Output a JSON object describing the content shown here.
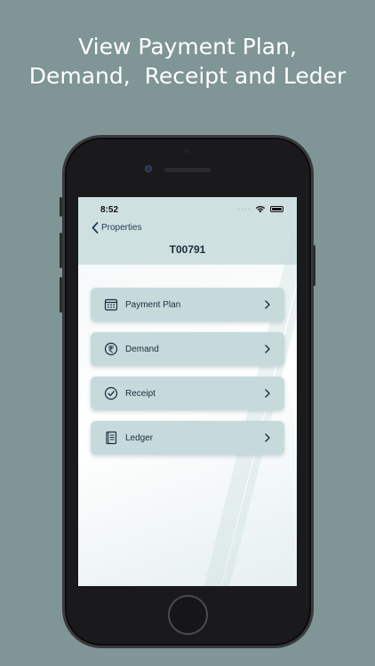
{
  "headline": {
    "line1": "View Payment Plan,",
    "line2": "Demand,  Receipt and Leder"
  },
  "status_bar": {
    "time": "8:52",
    "signal_dots": "····"
  },
  "nav": {
    "back_label": "Properties",
    "title": "T00791"
  },
  "menu": [
    {
      "label": "Payment Plan",
      "icon": "calendar-icon"
    },
    {
      "label": "Demand",
      "icon": "rupee-icon"
    },
    {
      "label": "Receipt",
      "icon": "checkmark-circle-icon"
    },
    {
      "label": "Ledger",
      "icon": "ledger-book-icon"
    }
  ],
  "colors": {
    "background": "#7f9596",
    "nav_bar": "#cfe0e1",
    "menu_item": "#c6dadc",
    "text_dark": "#1c2b3a"
  }
}
